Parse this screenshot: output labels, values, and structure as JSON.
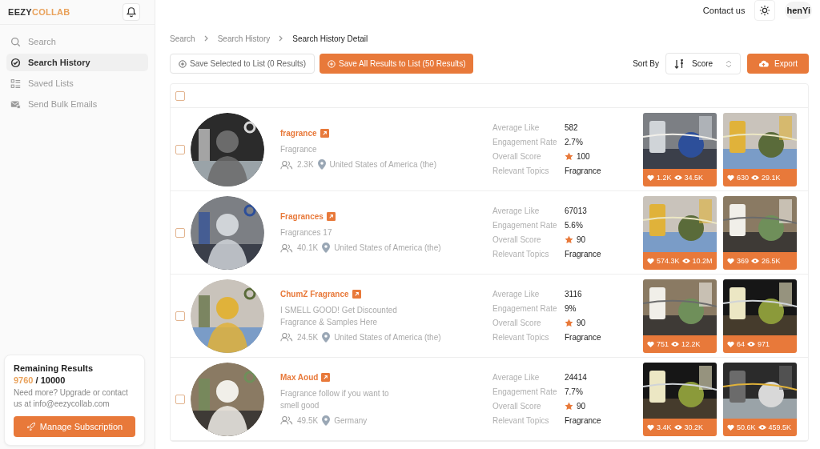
{
  "logo": {
    "dark": "EEZY",
    "accent": "COLLAB"
  },
  "nav": [
    {
      "label": "Search",
      "kind": "search",
      "selected": false
    },
    {
      "label": "Search History",
      "kind": "history",
      "selected": true
    },
    {
      "label": "Saved Lists",
      "kind": "list",
      "selected": false
    },
    {
      "label": "Send Bulk Emails",
      "kind": "mail",
      "selected": false
    }
  ],
  "quota": {
    "title": "Remaining Results",
    "used": "9760",
    "total": "/ 10000",
    "note": "Need more? Upgrade or contact us at info@eezycollab.com",
    "button": "Manage Subscription"
  },
  "topbar": {
    "contact": "Contact us",
    "user": "henYi"
  },
  "breadcrumb": [
    {
      "label": "Search",
      "current": false
    },
    {
      "label": "Search History",
      "current": false
    },
    {
      "label": "Search History Detail",
      "current": true
    }
  ],
  "actions": {
    "save_selected": "Save Selected to List (0 Results)",
    "save_all": "Save All Results to List (50 Results)",
    "sort_label": "Sort By",
    "sort_value": "Score",
    "export": "Export"
  },
  "select_all": {
    "checked": false
  },
  "rows": [
    {
      "checked": false,
      "name": "fragrance",
      "bio": "Fragrance",
      "followers": "2.3K",
      "location": "United States of America (the)",
      "metrics": [
        {
          "label": "Average Like",
          "value": "582",
          "kind": "plain"
        },
        {
          "label": "Engagement Rate",
          "value": "2.7%",
          "kind": "plain"
        },
        {
          "label": "Overall Score",
          "value": "100",
          "kind": "score"
        },
        {
          "label": "Relevant Topics",
          "value": "Fragrance",
          "kind": "plain"
        }
      ],
      "videos": [
        {
          "likes": "1.2K",
          "views": "34.5K"
        },
        {
          "likes": "630",
          "views": "29.1K"
        }
      ]
    },
    {
      "checked": false,
      "name": "Fragrances",
      "bio": "Fragrances 17",
      "followers": "40.1K",
      "location": "United States of America (the)",
      "metrics": [
        {
          "label": "Average Like",
          "value": "67013",
          "kind": "plain"
        },
        {
          "label": "Engagement Rate",
          "value": "5.6%",
          "kind": "plain"
        },
        {
          "label": "Overall Score",
          "value": "90",
          "kind": "score"
        },
        {
          "label": "Relevant Topics",
          "value": "Fragrance",
          "kind": "plain"
        }
      ],
      "videos": [
        {
          "likes": "574.3K",
          "views": "10.2M"
        },
        {
          "likes": "369",
          "views": "26.5K"
        }
      ]
    },
    {
      "checked": false,
      "name": "ChumZ Fragrance",
      "bio": "I SMELL GOOD! Get Discounted Fragrance & Samples Here",
      "followers": "24.5K",
      "location": "United States of America (the)",
      "metrics": [
        {
          "label": "Average Like",
          "value": "3116",
          "kind": "plain"
        },
        {
          "label": "Engagement Rate",
          "value": "9%",
          "kind": "plain"
        },
        {
          "label": "Overall Score",
          "value": "90",
          "kind": "score"
        },
        {
          "label": "Relevant Topics",
          "value": "Fragrance",
          "kind": "plain"
        }
      ],
      "videos": [
        {
          "likes": "751",
          "views": "12.2K"
        },
        {
          "likes": "64",
          "views": "971"
        }
      ]
    },
    {
      "checked": false,
      "name": "Max Aoud",
      "bio": "Fragrance follow if you want to smell good",
      "followers": "49.5K",
      "location": "Germany",
      "metrics": [
        {
          "label": "Average Like",
          "value": "24414",
          "kind": "plain"
        },
        {
          "label": "Engagement Rate",
          "value": "7.7%",
          "kind": "plain"
        },
        {
          "label": "Overall Score",
          "value": "90",
          "kind": "score"
        },
        {
          "label": "Relevant Topics",
          "value": "Fragrance",
          "kind": "plain"
        }
      ],
      "videos": [
        {
          "likes": "3.4K",
          "views": "30.2K"
        },
        {
          "likes": "50.6K",
          "views": "459.5K"
        }
      ]
    }
  ]
}
